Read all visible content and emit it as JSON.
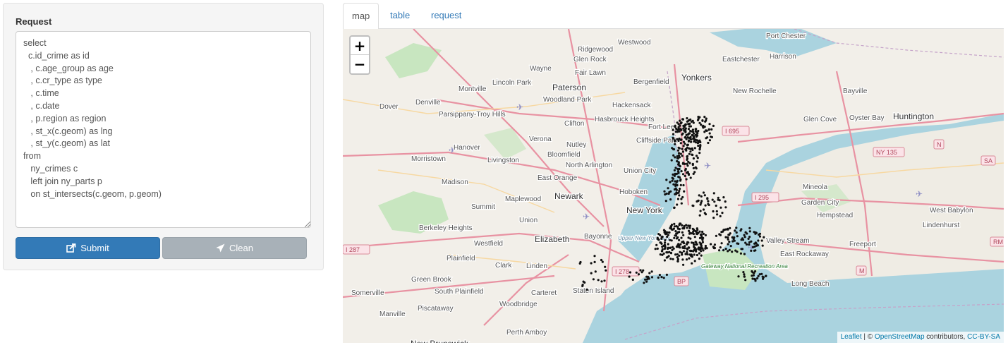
{
  "request_panel": {
    "heading": "Request",
    "query": "select\n  c.id_crime as id\n   , c.age_group as age\n   , c.cr_type as type\n   , c.time\n   , c.date\n   , p.region as region\n   , st_x(c.geom) as lng\n   , st_y(c.geom) as lat\nfrom\n   ny_crimes c\n   left join ny_parts p\n   on st_intersects(c.geom, p.geom)",
    "submit_label": "Submit",
    "clean_label": "Clean",
    "submit_icon": "share-square-icon",
    "clean_icon": "paper-plane-icon"
  },
  "tabs": [
    {
      "label": "map",
      "active": true
    },
    {
      "label": "table",
      "active": false
    },
    {
      "label": "request",
      "active": false
    }
  ],
  "map": {
    "zoom_in": "+",
    "zoom_out": "−",
    "place_labels": [
      "Port Chester",
      "Westwood",
      "Ridgewood",
      "Glen Rock",
      "Fair Lawn",
      "Wayne",
      "Eastchester",
      "Harrison",
      "Paterson",
      "Yonkers",
      "Bergenfield",
      "Lincoln Park",
      "Montville",
      "Woodland Park",
      "Hackensack",
      "New Rochelle",
      "Bayville",
      "Denville",
      "Dover",
      "Parsippany-Troy Hills",
      "Clifton",
      "Hasbrouck Heights",
      "Fort Lee",
      "Glen Cove",
      "Oyster Bay",
      "Huntington",
      "Cliffside Park",
      "Verona",
      "Nutley",
      "Hanover",
      "Bloomfield",
      "Morristown",
      "Livingston",
      "North Arlington",
      "Union City",
      "East Orange",
      "Madison",
      "Hoboken",
      "Newark",
      "Maplewood",
      "Summit",
      "Mineola",
      "Garden City",
      "West Babylon",
      "Hempstead",
      "Union",
      "New York",
      "Lindenhurst",
      "Berkeley Heights",
      "Elizabeth",
      "Bayonne",
      "Valley Stream",
      "Freeport",
      "Westfield",
      "East Rockaway",
      "Plainfield",
      "Clark",
      "Linden",
      "Gateway National Recreation Area",
      "Green Brook",
      "South Plainfield",
      "Carteret",
      "Staten Island",
      "Long Beach",
      "Somerville",
      "Woodbridge",
      "Piscataway",
      "Manville",
      "Perth Amboy",
      "New Brunswick",
      "Upper New York Bay"
    ],
    "road_shields": [
      "I 695",
      "NY 135",
      "N",
      "SA",
      "I 295",
      "I 287",
      "I 278",
      "BP",
      "M",
      "RM"
    ],
    "point_color": "#111111",
    "attribution": {
      "leaflet": "Leaflet",
      "sep": " | © ",
      "osm": "OpenStreetMap",
      "contributors": " contributors, ",
      "license": "CC-BY-SA"
    }
  }
}
